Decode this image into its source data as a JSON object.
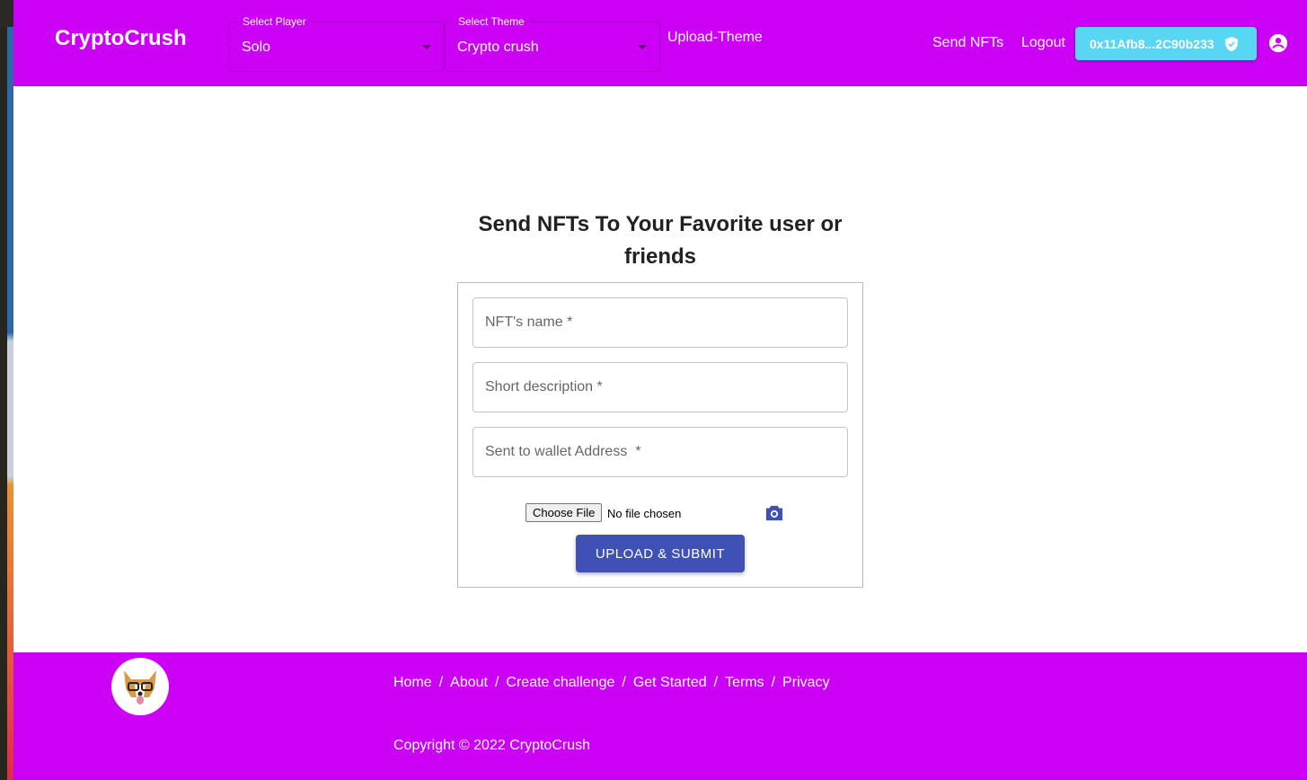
{
  "header": {
    "brand": "CryptoCrush",
    "player_select": {
      "label": "Select Player",
      "value": "Solo"
    },
    "theme_select": {
      "label": "Select Theme",
      "value": "Crypto crush"
    },
    "upload_theme": "Upload-Theme",
    "send_nfts": "Send NFTs",
    "logout": "Logout",
    "wallet": "0x11Afb8...2C90b233"
  },
  "main": {
    "title": "Send NFTs To Your Favorite user or friends",
    "fields": [
      "NFT's name *",
      "Short description *",
      "Sent to wallet Address  *"
    ],
    "choose_file": "Choose File",
    "no_file": "No file chosen",
    "submit": "UPLOAD & SUBMIT"
  },
  "footer": {
    "links": [
      "Home",
      "About",
      "Create challenge",
      "Get Started",
      "Terms",
      "Privacy"
    ],
    "separator": "/",
    "copyright": "Copyright © 2022 CryptoCrush"
  },
  "colors": {
    "brand": "#cc00f5",
    "wallet": "#5ad6f5",
    "button": "#3f51b5"
  }
}
